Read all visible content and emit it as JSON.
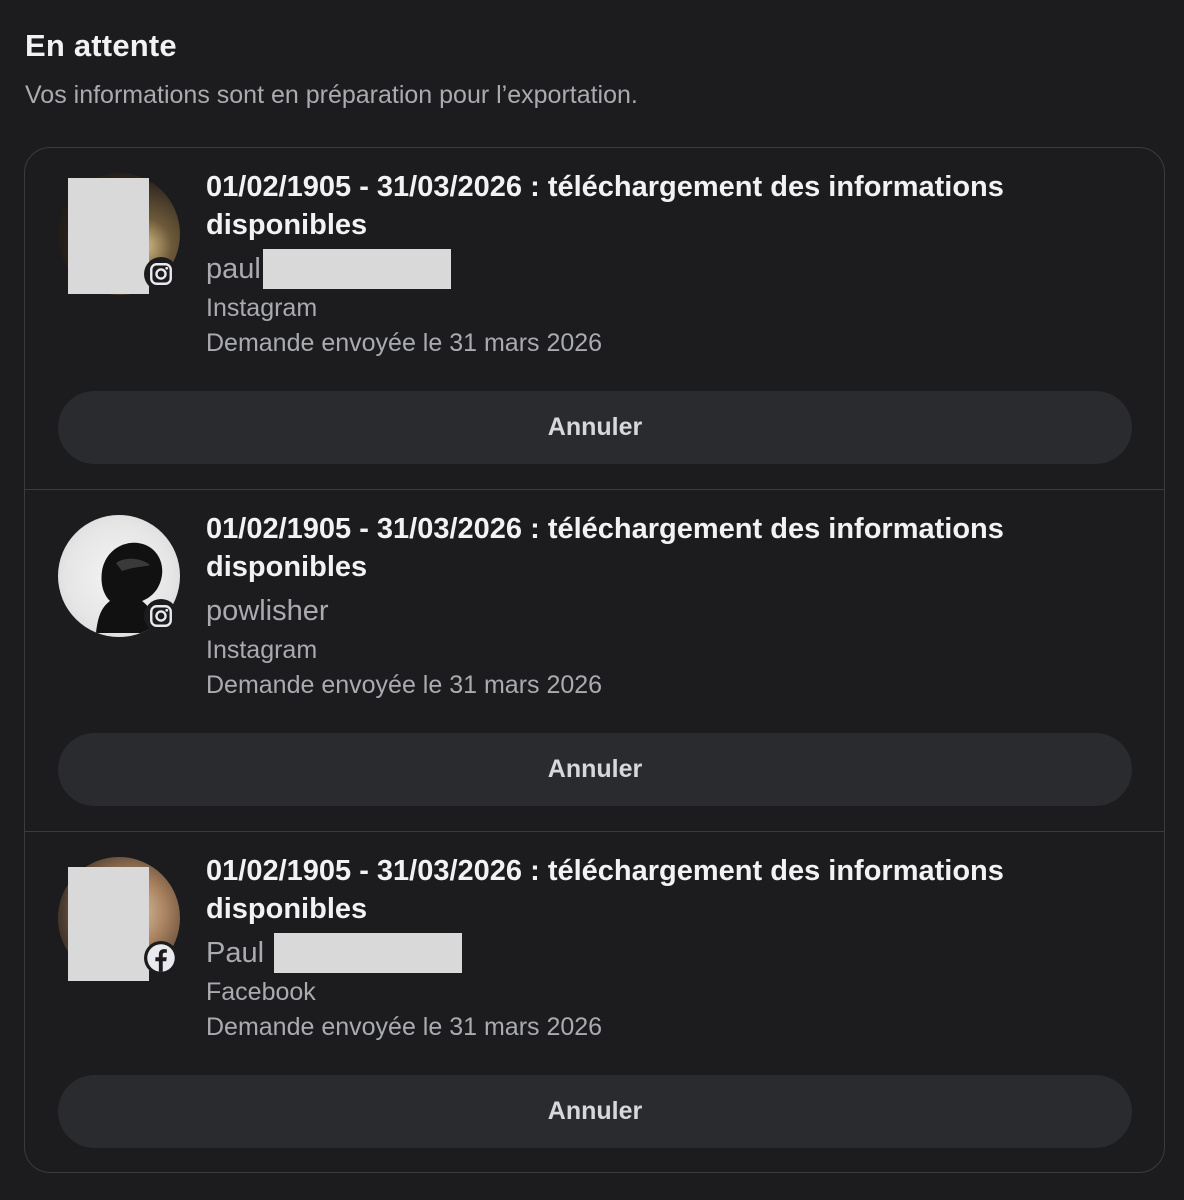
{
  "header": {
    "title": "En attente",
    "subtitle": "Vos informations sont en préparation pour l’exportation."
  },
  "requests": [
    {
      "title": "01/02/1905 - 31/03/2026 : téléchargement des informations disponibles",
      "account": "paul",
      "platform": "Instagram",
      "date": "Demande envoyée le 31 mars 2026",
      "cancel_label": "Annuler",
      "badge_icon": "instagram-icon"
    },
    {
      "title": "01/02/1905 - 31/03/2026 : téléchargement des informations disponibles",
      "account": "powlisher",
      "platform": "Instagram",
      "date": "Demande envoyée le 31 mars 2026",
      "cancel_label": "Annuler",
      "badge_icon": "instagram-icon"
    },
    {
      "title": "01/02/1905 - 31/03/2026 : téléchargement des informations disponibles",
      "account": "Paul",
      "platform": "Facebook",
      "date": "Demande envoyée le 31 mars 2026",
      "cancel_label": "Annuler",
      "badge_icon": "facebook-icon"
    }
  ],
  "colors": {
    "background": "#1c1c1e",
    "primary_text": "#f2f2f4",
    "secondary_text": "#a9abb0",
    "button_bg": "#2a2b2f",
    "border": "#3a3b3f"
  }
}
